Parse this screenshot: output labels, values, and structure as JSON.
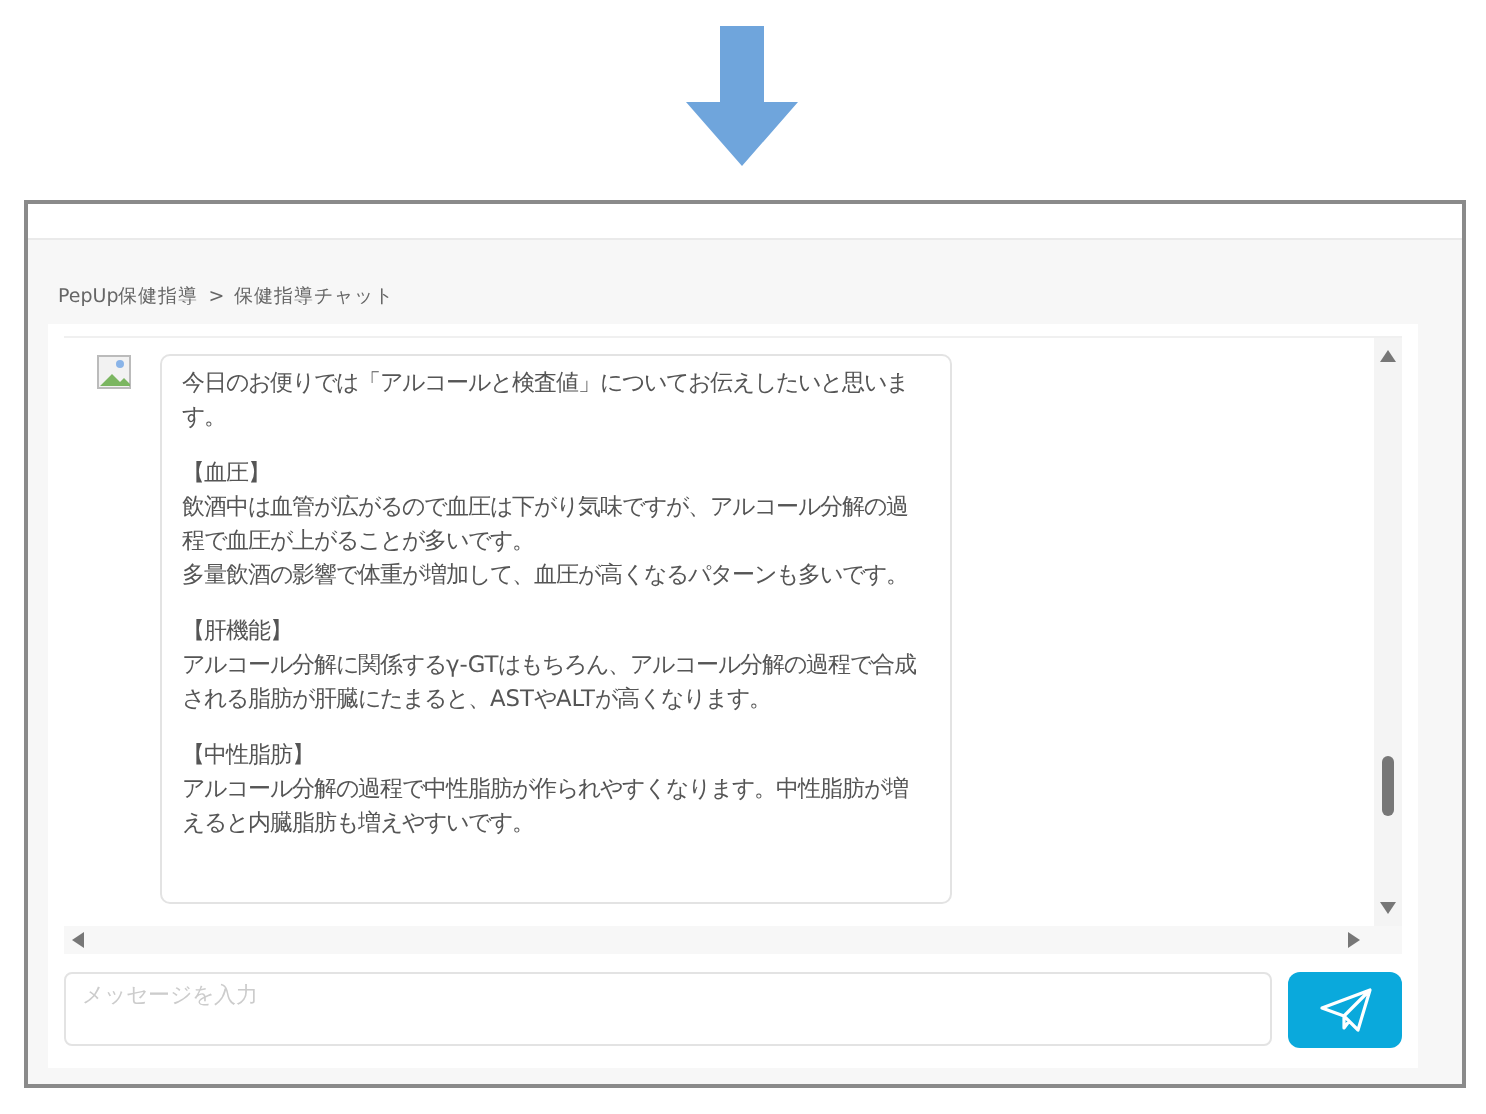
{
  "breadcrumb": {
    "parent": "PepUp保健指導",
    "separator": ">",
    "current": "保健指導チャット"
  },
  "message": {
    "blocks": [
      {
        "lines": [
          "今日のお便りでは「アルコールと検査値」についてお伝えしたいと思います。"
        ]
      },
      {
        "lines": [
          "【血圧】",
          "飲酒中は血管が広がるので血圧は下がり気味ですが、アルコール分解の過程で血圧が上がることが多いです。",
          "多量飲酒の影響で体重が増加して、血圧が高くなるパターンも多いです。"
        ]
      },
      {
        "lines": [
          "【肝機能】",
          "アルコール分解に関係するγ‐GTはもちろん、アルコール分解の過程で合成される脂肪が肝臓にたまると、ASTやALTが高くなります。"
        ]
      },
      {
        "lines": [
          "【中性脂肪】",
          "アルコール分解の過程で中性脂肪が作られやすくなります。中性脂肪が増えると内臓脂肪も増えやすいです。"
        ]
      }
    ]
  },
  "composer": {
    "placeholder": "メッセージを入力"
  }
}
